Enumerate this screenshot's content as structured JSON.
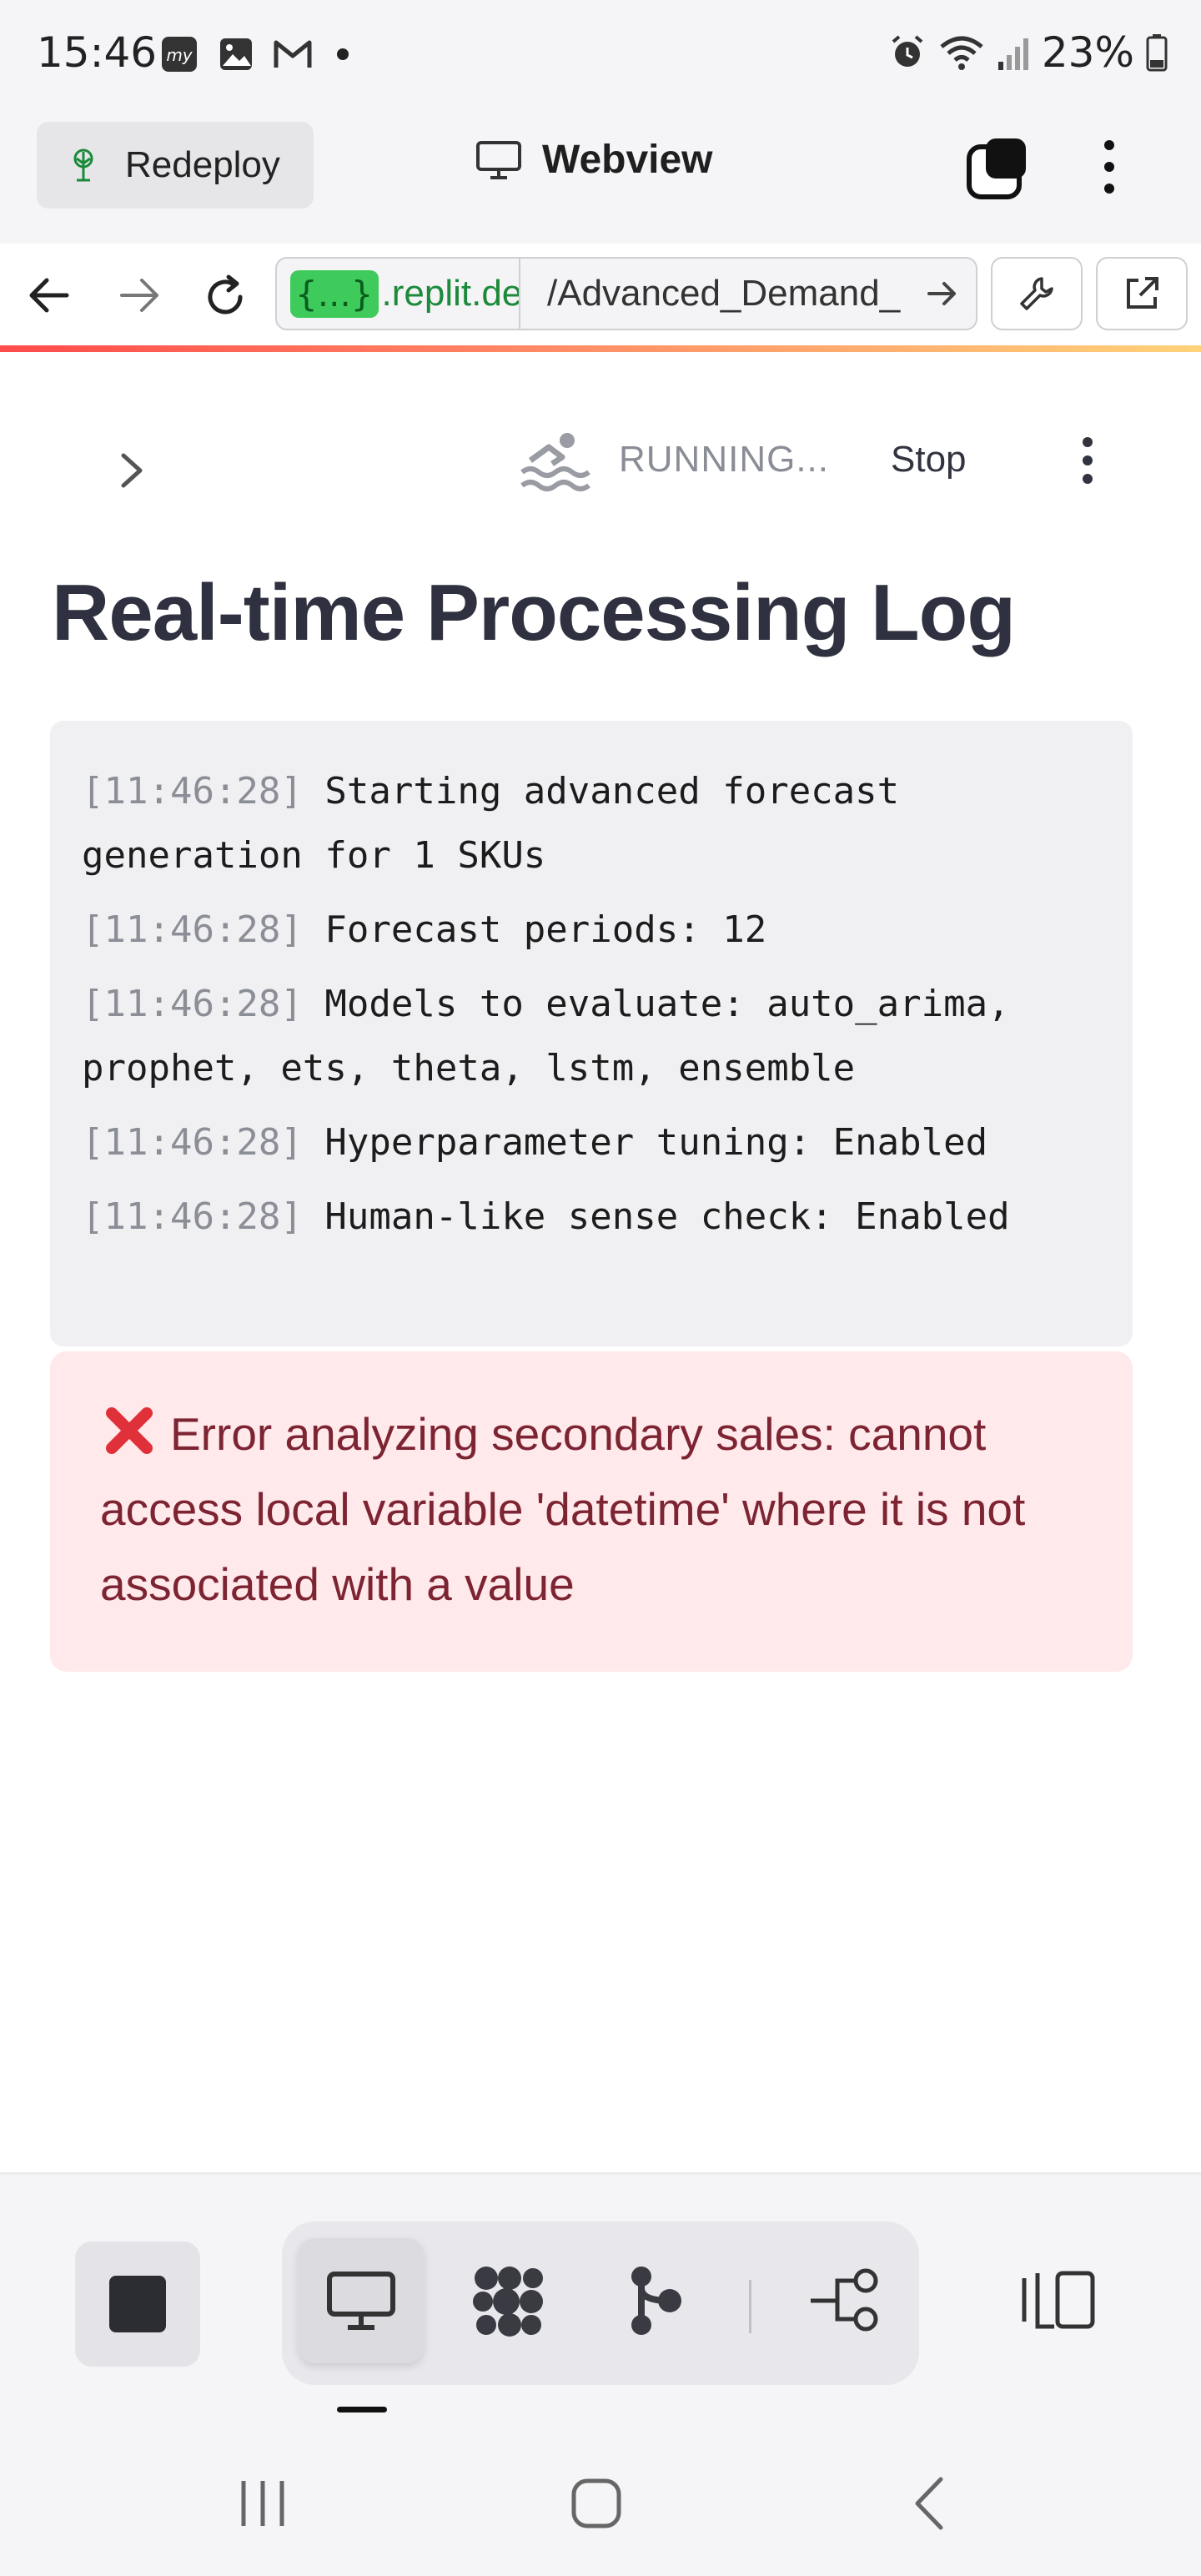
{
  "status_bar": {
    "time": "15:46",
    "battery_percent": "23%",
    "icons": [
      "myjio-icon",
      "gallery-icon",
      "gmail-icon",
      "notification-dot",
      "alarm-icon",
      "wifi-icon",
      "signal-icon",
      "battery-icon"
    ]
  },
  "toolbar": {
    "redeploy_label": "Redeploy",
    "webview_label": "Webview"
  },
  "url_bar": {
    "host_badge": "{...}",
    "host_text": ".replit.de",
    "path": "/Advanced_Demand_"
  },
  "app_header": {
    "status_label": "RUNNING...",
    "stop_label": "Stop"
  },
  "main": {
    "title": "Real-time Processing Log",
    "log_lines": [
      {
        "ts": "[11:46:28]",
        "msg": " Starting advanced forecast generation for 1 SKUs"
      },
      {
        "ts": "[11:46:28]",
        "msg": " Forecast periods: 12"
      },
      {
        "ts": "[11:46:28]",
        "msg": " Models to evaluate: auto_arima, prophet, ets, theta, lstm, ensemble"
      },
      {
        "ts": "[11:46:28]",
        "msg": " Hyperparameter tuning: Enabled"
      },
      {
        "ts": "[11:46:28]",
        "msg": " Human-like sense check: Enabled"
      }
    ],
    "error_message": "Error analyzing secondary sales: cannot access local variable 'datetime' where it is not associated with a value"
  },
  "colors": {
    "accent_gradient_start": "#ff4b4b",
    "accent_gradient_end": "#ffd27a",
    "error_bg": "#ffe9ea",
    "error_text": "#7d2433",
    "url_badge": "#3fcb5b"
  }
}
